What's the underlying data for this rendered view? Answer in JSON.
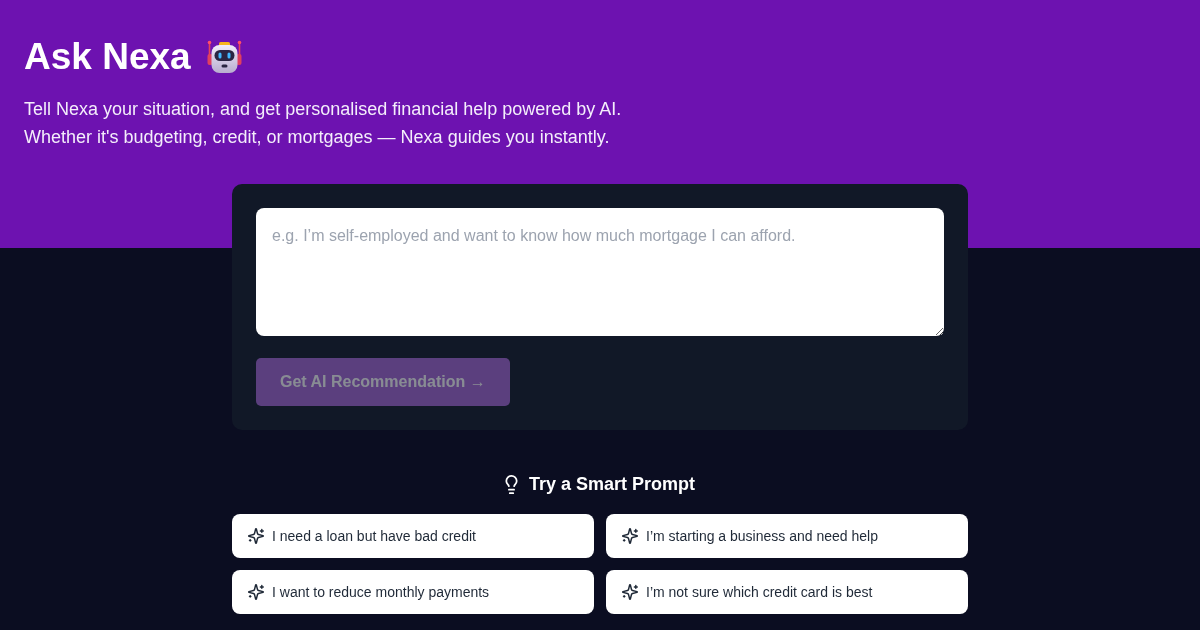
{
  "header": {
    "title": "Ask Nexa",
    "subtitle_lines": [
      "Tell Nexa your situation, and get personalised financial help powered by AI.",
      "Whether it's budgeting, credit, or mortgages — Nexa guides you instantly."
    ]
  },
  "query_card": {
    "input": {
      "placeholder": "e.g. I’m self-employed and want to know how much mortgage I can afford."
    },
    "submit_button": {
      "label": "Get AI Recommendation →",
      "disabled": true
    }
  },
  "smart_prompts": {
    "heading": "Try a Smart Prompt",
    "prompts": [
      "I need a loan but have bad credit",
      "I’m starting a business and need help",
      "I want to reduce monthly payments",
      "I’m not sure which credit card is best"
    ]
  }
}
